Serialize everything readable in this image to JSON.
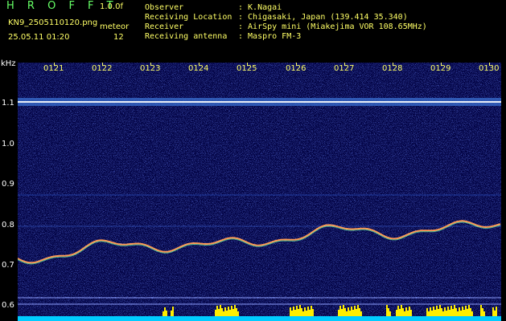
{
  "header": {
    "app_title": "H R O F F T",
    "version": "1.0.0f",
    "filename": "KN9_2505110120.png",
    "datetime": "25.05.11 01:20",
    "meteor_label": "meteor",
    "meteor_count": "12"
  },
  "info": [
    {
      "label": "Observer",
      "value": ": K.Nagai"
    },
    {
      "label": "Receiving Location",
      "value": ": Chigasaki, Japan (139.414 35.340)"
    },
    {
      "label": "Receiver",
      "value": ": AirSpy mini (Miakejima VOR 108.65MHz)"
    },
    {
      "label": "Receiving antenna",
      "value": ": Maspro FM-3"
    }
  ],
  "axis": {
    "y_unit": "kHz",
    "y_ticks": [
      "1.1",
      "1.0",
      "0.9",
      "0.8",
      "0.7",
      "0.6"
    ],
    "x_ticks": [
      "0121",
      "0122",
      "0123",
      "0124",
      "0125",
      "0126",
      "0127",
      "0128",
      "0129",
      "0130"
    ]
  },
  "colors": {
    "header_text": "#ffff66",
    "title": "#66ff66",
    "background": "#000044",
    "activity_bar": "#ffee00",
    "baseline": "#00ccff"
  }
}
